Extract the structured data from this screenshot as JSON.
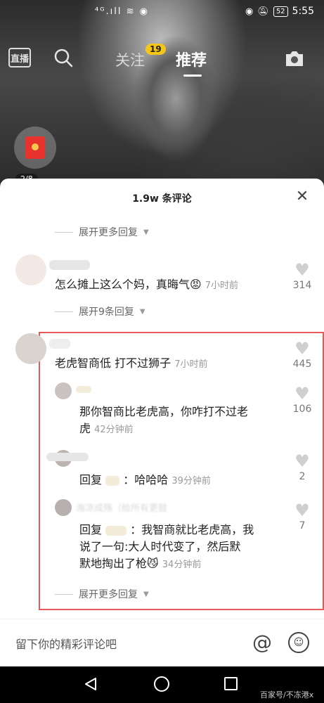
{
  "status_bar": {
    "signal": "⁴ᴳ.ıll ≋ ◉",
    "battery": "52",
    "time": "5:55"
  },
  "top_nav": {
    "live_label": "直播",
    "follow_tab": "关注",
    "follow_badge": "19",
    "recommend_tab": "推荐"
  },
  "red_packet": {
    "count": "2/8"
  },
  "sheet": {
    "title": "1.9w 条评论",
    "close_glyph": "✕",
    "expand_more_replies": "展开更多回复",
    "expand_9_replies": "展开9条回复",
    "expand_more_replies_bottom": "展开更多回复"
  },
  "comments": [
    {
      "text": "怎么摊上这么个妈，真晦气😡",
      "time": "7小时前",
      "likes": "314"
    },
    {
      "text": "老虎智商低 打不过狮子",
      "time": "7小时前",
      "likes": "445"
    }
  ],
  "replies": [
    {
      "text_line1": "那你智商比老虎高，你咋打不过老",
      "text_line2": "虎",
      "time": "42分钟前",
      "likes": "106"
    },
    {
      "text_prefix": "回复",
      "text_body": "：哈哈哈",
      "time": "39分钟前",
      "likes": "2"
    },
    {
      "author": "海凉成殇（给所有更鼓",
      "text_prefix": "回复",
      "text_line1": "：我智商就比老虎高，我",
      "text_line2": "说了一句:大人时代变了，然后默",
      "text_line3": "默地掏出了枪😼",
      "time": "34分钟前",
      "likes": "7"
    }
  ],
  "input_bar": {
    "placeholder": "留下你的精彩评论吧",
    "at_glyph": "@",
    "emoji_glyph": "☺"
  },
  "watermark": "百家号/不冻港x",
  "colors": {
    "highlight": "#e85a5a",
    "badge": "#f5c518",
    "red_packet": "#e8322d"
  }
}
